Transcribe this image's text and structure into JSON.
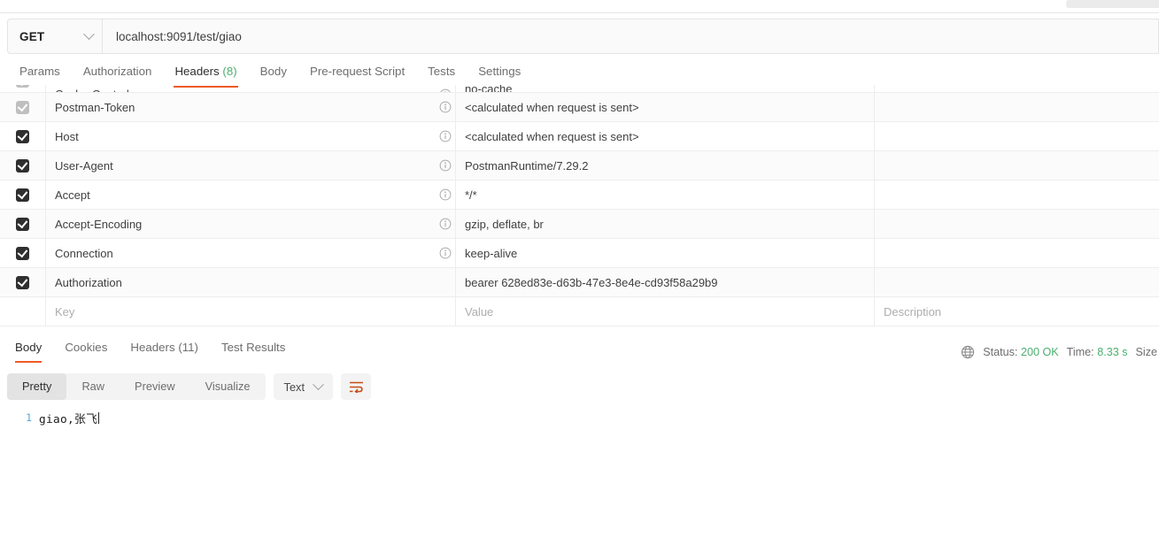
{
  "request": {
    "method": "GET",
    "url": "localhost:9091/test/giao",
    "tabs": [
      {
        "label": "Params",
        "active": false,
        "count": ""
      },
      {
        "label": "Authorization",
        "active": false,
        "count": ""
      },
      {
        "label": "Headers",
        "active": true,
        "count": "(8)"
      },
      {
        "label": "Body",
        "active": false,
        "count": ""
      },
      {
        "label": "Pre-request Script",
        "active": false,
        "count": ""
      },
      {
        "label": "Tests",
        "active": false,
        "count": ""
      },
      {
        "label": "Settings",
        "active": false,
        "count": ""
      }
    ]
  },
  "headers_table": {
    "placeholders": {
      "key": "Key",
      "value": "Value",
      "description": "Description"
    },
    "rows": [
      {
        "key": "Cache-Control",
        "value": "no-cache",
        "checked": true,
        "disabled": true,
        "info": true,
        "clipped": true
      },
      {
        "key": "Postman-Token",
        "value": "<calculated when request is sent>",
        "checked": true,
        "disabled": true,
        "info": true,
        "clipped": false
      },
      {
        "key": "Host",
        "value": "<calculated when request is sent>",
        "checked": true,
        "disabled": false,
        "info": true,
        "clipped": false
      },
      {
        "key": "User-Agent",
        "value": "PostmanRuntime/7.29.2",
        "checked": true,
        "disabled": false,
        "info": true,
        "clipped": false
      },
      {
        "key": "Accept",
        "value": "*/*",
        "checked": true,
        "disabled": false,
        "info": true,
        "clipped": false
      },
      {
        "key": "Accept-Encoding",
        "value": "gzip, deflate, br",
        "checked": true,
        "disabled": false,
        "info": true,
        "clipped": false
      },
      {
        "key": "Connection",
        "value": "keep-alive",
        "checked": true,
        "disabled": false,
        "info": true,
        "clipped": false
      },
      {
        "key": "Authorization",
        "value": "bearer 628ed83e-d63b-47e3-8e4e-cd93f58a29b9",
        "checked": true,
        "disabled": false,
        "info": false,
        "clipped": false
      }
    ]
  },
  "response": {
    "tabs": [
      {
        "label": "Body",
        "active": true
      },
      {
        "label": "Cookies",
        "active": false
      },
      {
        "label": "Headers (11)",
        "active": false
      },
      {
        "label": "Test Results",
        "active": false
      }
    ],
    "status": {
      "label": "Status:",
      "value": "200 OK"
    },
    "time": {
      "label": "Time:",
      "value": "8.33 s"
    },
    "size": {
      "label": "Size"
    },
    "view_modes": [
      {
        "label": "Pretty",
        "active": true
      },
      {
        "label": "Raw",
        "active": false
      },
      {
        "label": "Preview",
        "active": false
      },
      {
        "label": "Visualize",
        "active": false
      }
    ],
    "format": "Text",
    "body": {
      "line_number": "1",
      "text": "giao,张飞"
    }
  },
  "colors": {
    "accent": "#ef5b25",
    "success": "#4caf70",
    "text": "#3f3f3f",
    "muted": "#adadad"
  }
}
